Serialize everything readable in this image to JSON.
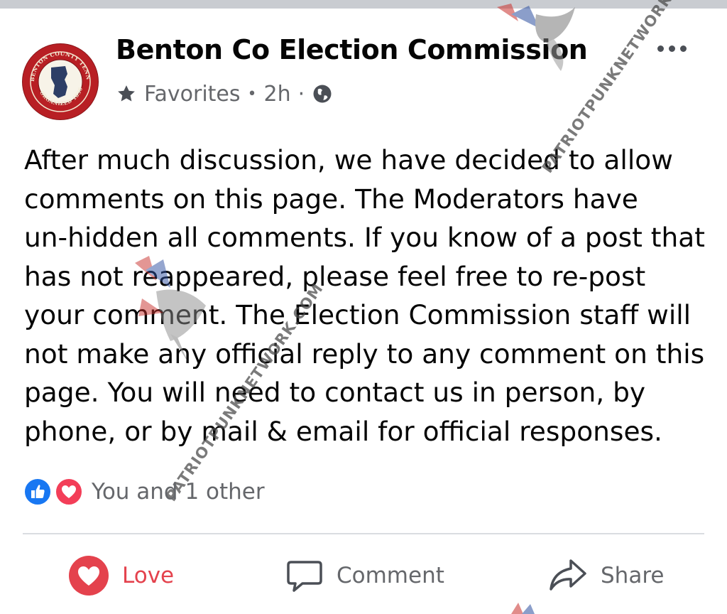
{
  "post": {
    "page_name": "Benton Co Election Commission",
    "meta": {
      "favorites_label": "Favorites",
      "separator_1": "•",
      "time": "2h",
      "separator_2": "·",
      "audience_icon": "globe-icon"
    },
    "body": "After much discussion, we have decided to allow\ncomments on this page. The Moderators have\nun-hidden all comments. If you know of a post that\nhas not reappeared, please feel free to re-post\nyour comment. The Election Commission staff will\nnot make any official reply to any comment on this\npage. You will need to contact us in person, by\nphone, or by mail & email for official responses."
  },
  "logo": {
    "top_text": "BENTON COUNTY TENNESSEE",
    "bottom_text": "ORGANIZED 1836",
    "color": "#b81f24"
  },
  "reactions": {
    "icons": [
      "like-icon",
      "heart-icon"
    ],
    "text": "You and 1 other"
  },
  "actions": {
    "love": "Love",
    "comment": "Comment",
    "share": "Share"
  },
  "watermarks": [
    "PATRIOTPUNKNETWORK.COM",
    "PATRIOTPUNKNETWORK.COM"
  ],
  "colors": {
    "love_active": "#e4424d",
    "like_blue": "#1877f2",
    "heart_red": "#f33e58",
    "meta_gray": "#65676b"
  }
}
